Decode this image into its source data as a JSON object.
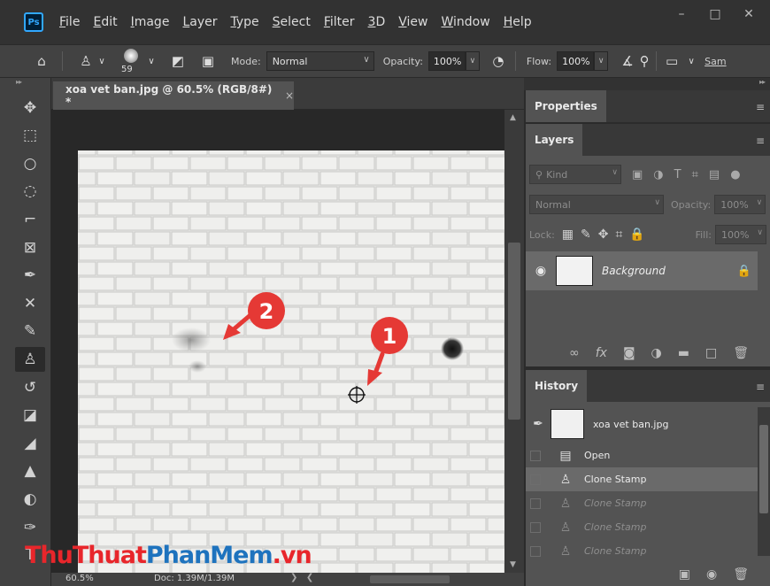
{
  "app": {
    "logo_text": "Ps"
  },
  "menu": [
    "File",
    "Edit",
    "Image",
    "Layer",
    "Type",
    "Select",
    "Filter",
    "3D",
    "View",
    "Window",
    "Help"
  ],
  "options": {
    "brush_size": "59",
    "mode_label": "Mode:",
    "mode_value": "Normal",
    "opacity_label": "Opacity:",
    "opacity_value": "100%",
    "flow_label": "Flow:",
    "flow_value": "100%",
    "sample_label": "Sam"
  },
  "document": {
    "tab_title": "xoa vet ban.jpg @ 60.5% (RGB/8#) *",
    "close_glyph": "×",
    "zoom": "60.5%",
    "doc_info": "Doc: 1.39M/1.39M",
    "callout_1": "1",
    "callout_2": "2"
  },
  "panels": {
    "properties_title": "Properties",
    "layers": {
      "title": "Layers",
      "kind_placeholder": "Kind",
      "blend_mode": "Normal",
      "opacity_label": "Opacity:",
      "opacity_value": "100%",
      "lock_label": "Lock:",
      "fill_label": "Fill:",
      "fill_value": "100%",
      "layer_name": "Background"
    },
    "history": {
      "title": "History",
      "snapshot_name": "xoa vet ban.jpg",
      "items": [
        "Open",
        "Clone Stamp",
        "Clone Stamp",
        "Clone Stamp",
        "Clone Stamp"
      ]
    }
  },
  "watermark": {
    "part1": "ThuThuat",
    "part2": "PhanMem",
    "part3": ".vn"
  },
  "colors": {
    "accent": "#31a8ff",
    "watermark_red": "#e8262b",
    "watermark_blue": "#1e73be"
  }
}
